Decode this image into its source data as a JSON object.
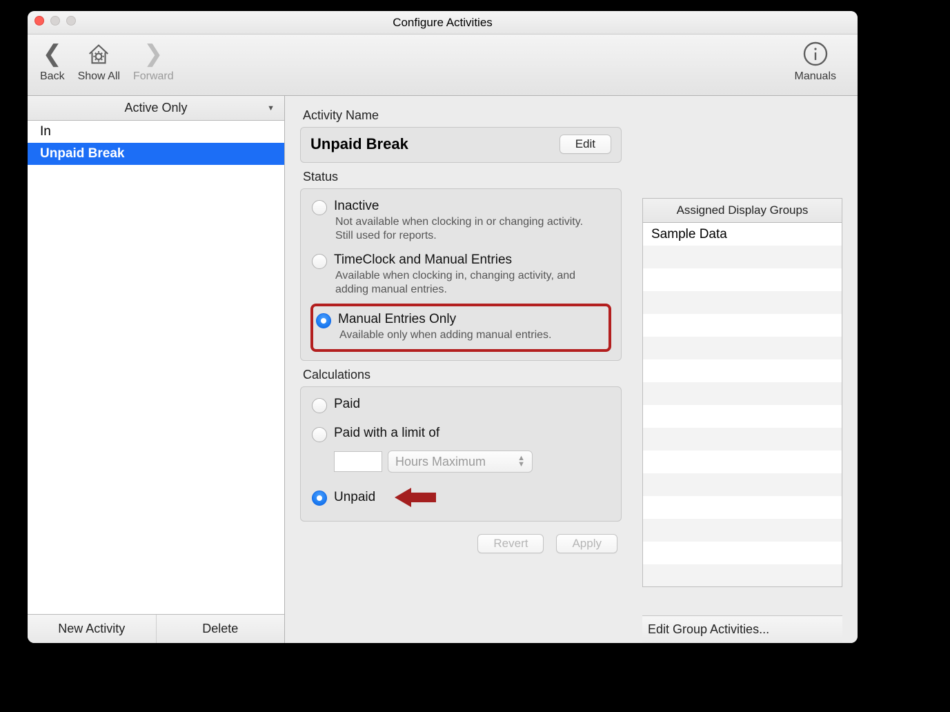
{
  "window": {
    "title": "Configure Activities"
  },
  "toolbar": {
    "back": "Back",
    "show_all": "Show All",
    "forward": "Forward",
    "manuals": "Manuals"
  },
  "sidebar": {
    "filter": "Active Only",
    "items": [
      {
        "label": "In",
        "selected": false
      },
      {
        "label": "Unpaid Break",
        "selected": true
      }
    ],
    "new_activity": "New Activity",
    "delete": "Delete"
  },
  "main": {
    "activity_name_label": "Activity Name",
    "activity_name": "Unpaid Break",
    "edit": "Edit",
    "status_label": "Status",
    "status_options": [
      {
        "title": "Inactive",
        "desc": "Not available when clocking in or changing activity. Still used for reports.",
        "selected": false
      },
      {
        "title": "TimeClock and Manual Entries",
        "desc": "Available when clocking in, changing activity, and adding manual entries.",
        "selected": false
      },
      {
        "title": "Manual Entries Only",
        "desc": "Available only when adding manual entries.",
        "selected": true
      }
    ],
    "calc_label": "Calculations",
    "calc_options": {
      "paid": "Paid",
      "paid_limit": "Paid with a limit of",
      "limit_value": "",
      "limit_unit": "Hours Maximum",
      "unpaid": "Unpaid",
      "selected": "unpaid"
    },
    "revert": "Revert",
    "apply": "Apply"
  },
  "groups": {
    "header": "Assigned Display Groups",
    "rows": [
      "Sample Data"
    ],
    "edit": "Edit Group Activities..."
  }
}
